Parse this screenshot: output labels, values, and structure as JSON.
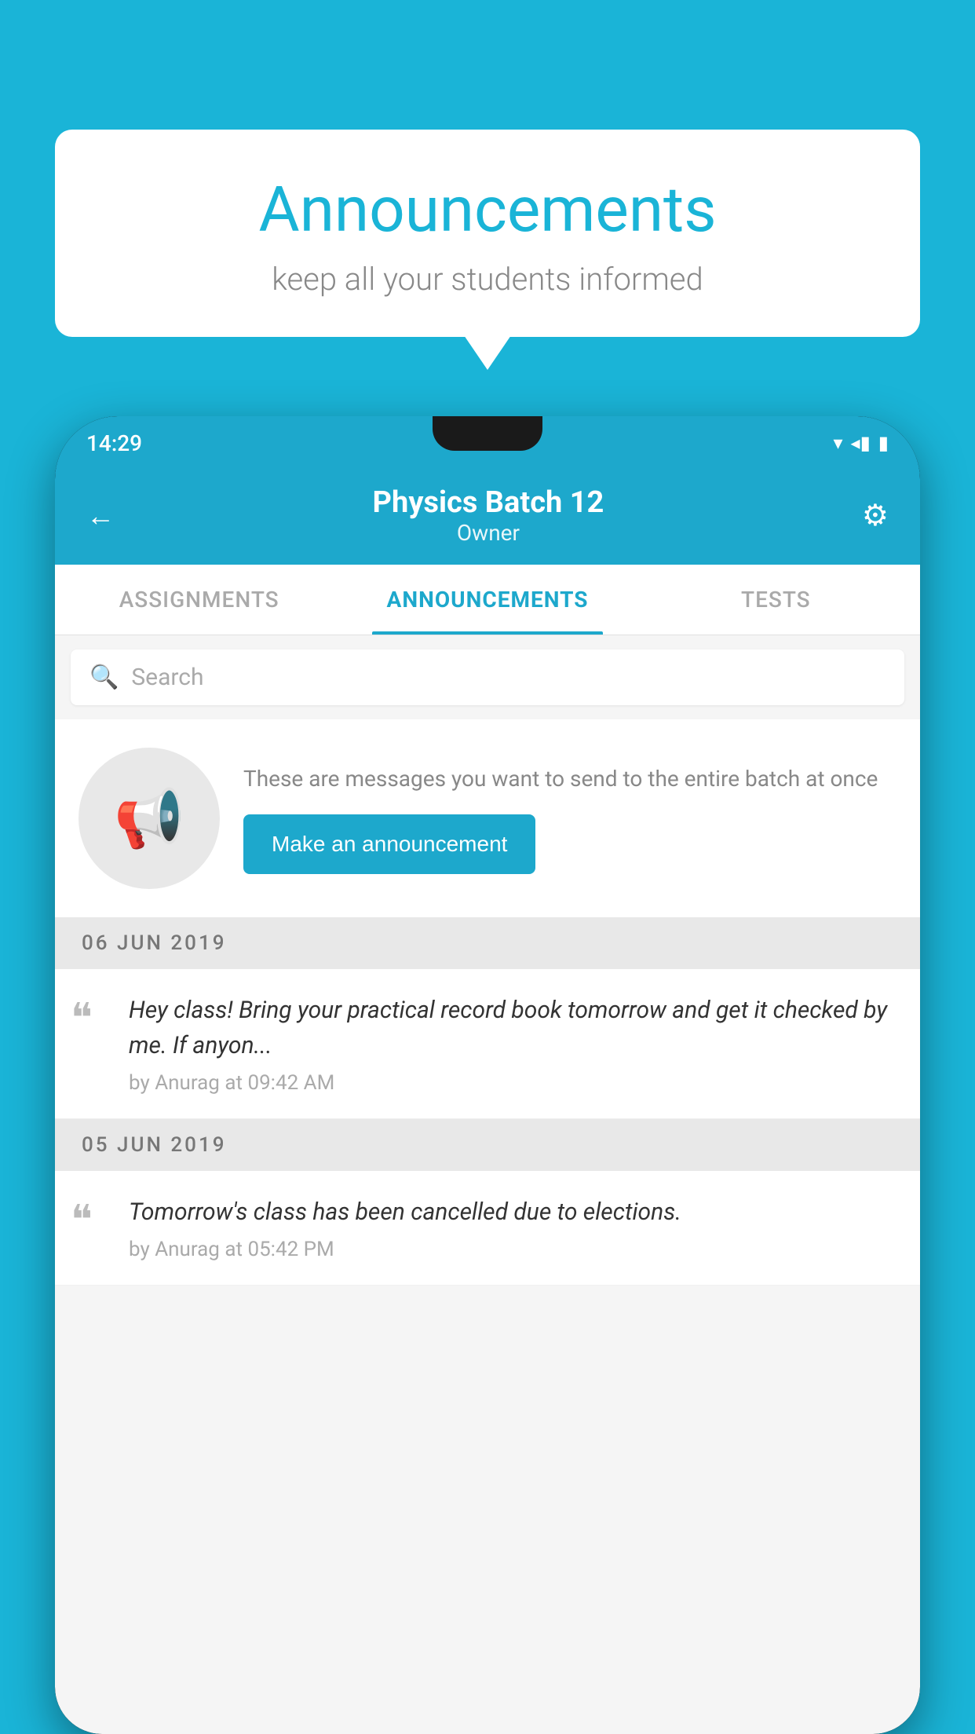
{
  "bubble": {
    "title": "Announcements",
    "subtitle": "keep all your students informed"
  },
  "statusBar": {
    "time": "14:29",
    "icons": [
      "▾◂▮"
    ]
  },
  "header": {
    "title": "Physics Batch 12",
    "subtitle": "Owner"
  },
  "tabs": [
    {
      "label": "ASSIGNMENTS",
      "active": false
    },
    {
      "label": "ANNOUNCEMENTS",
      "active": true
    },
    {
      "label": "TESTS",
      "active": false
    }
  ],
  "search": {
    "placeholder": "Search"
  },
  "promptSection": {
    "description": "These are messages you want to send to the entire batch at once",
    "buttonLabel": "Make an announcement"
  },
  "announcements": [
    {
      "date": "06  JUN  2019",
      "message": "Hey class! Bring your practical record book tomorrow and get it checked by me. If anyon...",
      "meta": "by Anurag at 09:42 AM"
    },
    {
      "date": "05  JUN  2019",
      "message": "Tomorrow's class has been cancelled due to elections.",
      "meta": "by Anurag at 05:42 PM"
    }
  ],
  "colors": {
    "primary": "#1da8cc",
    "background": "#1ab4d7",
    "tabActive": "#1da8cc",
    "tabInactive": "#aaa"
  }
}
